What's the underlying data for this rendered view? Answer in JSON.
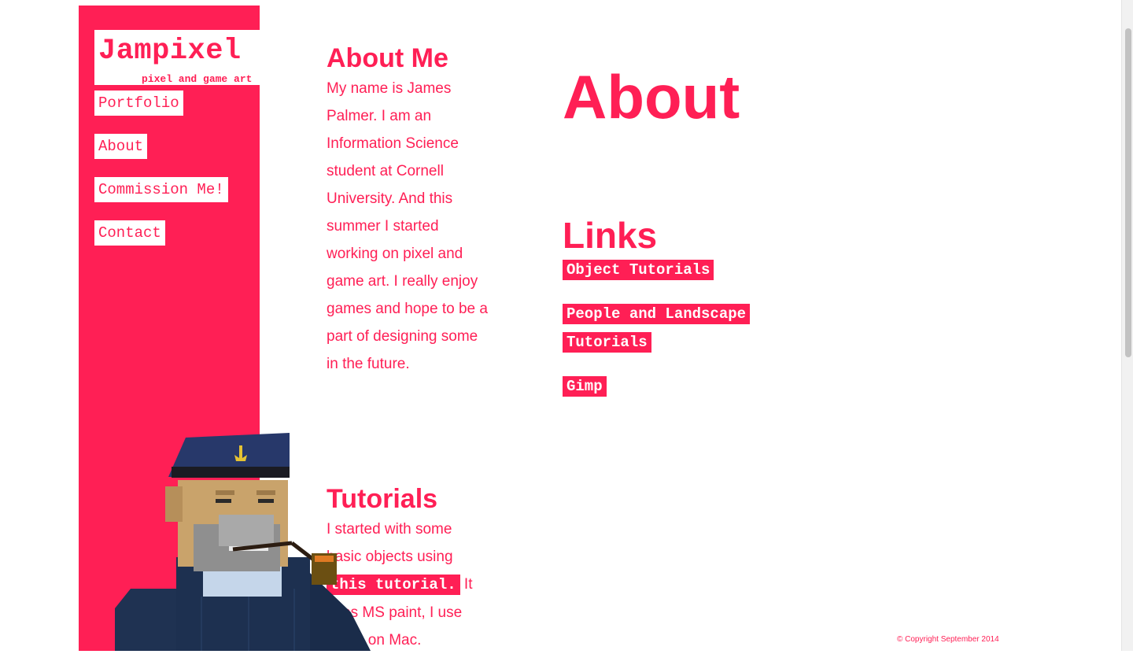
{
  "brand": {
    "title": "Jampixel",
    "subtitle": "pixel and game art"
  },
  "nav": [
    {
      "label": "Portfolio"
    },
    {
      "label": "About"
    },
    {
      "label": "Commission Me!"
    },
    {
      "label": "Contact"
    }
  ],
  "about_me": {
    "heading": "About Me",
    "text": "My name is James Palmer. I am an Information Science student at Cornell University. And this summer I started working on pixel and game art. I really enjoy games and hope to be a part of designing some in the future."
  },
  "tutorials": {
    "heading": "Tutorials",
    "text_before": "I started with some basic objects using ",
    "link": "this tutorial.",
    "text_after": " It uses MS paint, I use brush on Mac."
  },
  "page_title": "About",
  "links": {
    "heading": "Links",
    "items": [
      {
        "label": "Object Tutorials"
      },
      {
        "label": "People and Landscape Tutorials"
      },
      {
        "label": "Gimp"
      }
    ]
  },
  "footer": {
    "copyright": "© Copyright September 2014"
  },
  "colors": {
    "accent": "#ff1f55",
    "background": "#ffffff"
  }
}
